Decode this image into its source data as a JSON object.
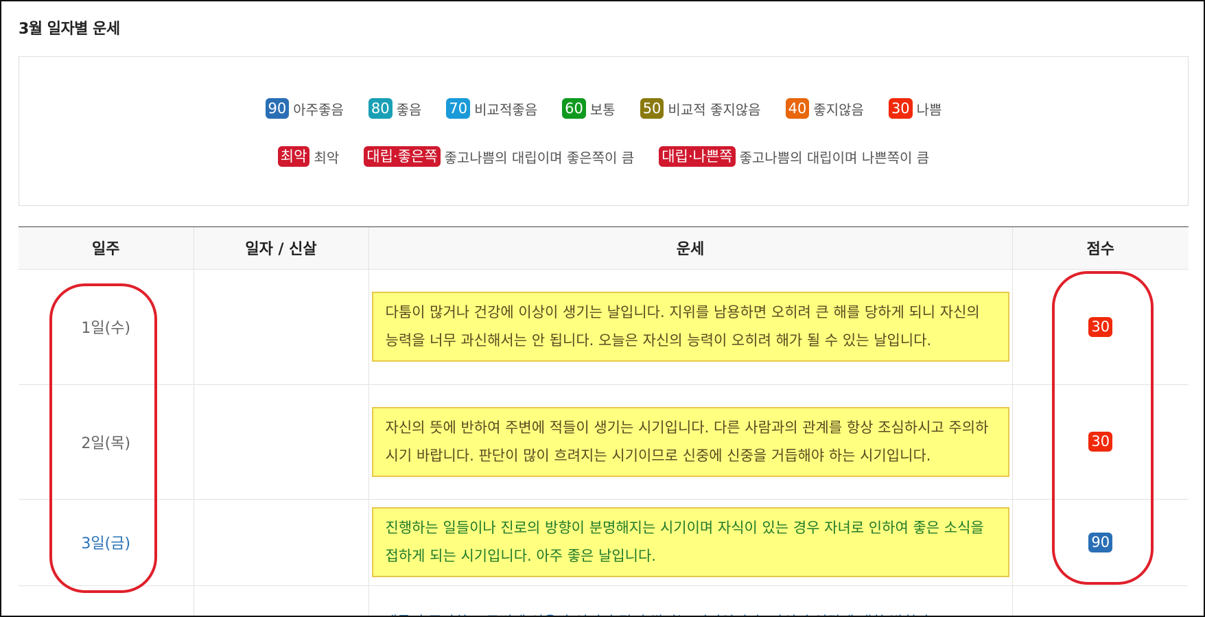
{
  "page_title": "3월 일자별 운세",
  "legend": {
    "row1": [
      {
        "badge": "90",
        "label": "아주좋음",
        "color": "#2a6fb5"
      },
      {
        "badge": "80",
        "label": "좋음",
        "color": "#1aa0b5"
      },
      {
        "badge": "70",
        "label": "비교적좋음",
        "color": "#1a9ad8"
      },
      {
        "badge": "60",
        "label": "보통",
        "color": "#0f9a1f"
      },
      {
        "badge": "50",
        "label": "비교적 좋지않음",
        "color": "#8a7a10"
      },
      {
        "badge": "40",
        "label": "좋지않음",
        "color": "#e8660e"
      },
      {
        "badge": "30",
        "label": "나쁨",
        "color": "#f02a0a"
      }
    ],
    "row2": [
      {
        "badge": "최악",
        "label": "최악",
        "color": "#d0192e"
      },
      {
        "badge": "대립·좋은쪽",
        "label": "좋고나쁨의 대립이며 좋은쪽이 큼",
        "color": "#d0192e"
      },
      {
        "badge": "대립·나쁜쪽",
        "label": "좋고나쁨의 대립이며 나쁜쪽이 큼",
        "color": "#d0192e"
      }
    ]
  },
  "table": {
    "headers": [
      "일주",
      "일자 / 신살",
      "운세",
      "점수"
    ],
    "rows": [
      {
        "day": "1일(수)",
        "shinsal": "",
        "fortune": "다툼이 많거나 건강에 이상이 생기는 날입니다. 지위를 남용하면 오히려 큰 해를 당하게 되니 자신의 능력을 너무 과신해서는 안 됩니다. 오늘은 자신의 능력이 오히려 해가 될 수 있는 날입니다.",
        "score": "30",
        "score_color": "#f02a0a"
      },
      {
        "day": "2일(목)",
        "shinsal": "",
        "fortune": "자신의 뜻에 반하여 주변에 적들이 생기는 시기입니다. 다른 사람과의 관계를 항상 조심하시고 주의하시기 바랍니다. 판단이 많이 흐려지는 시기이므로 신중에 신중을 거듭해야 하는 시기입니다.",
        "score": "30",
        "score_color": "#f02a0a"
      },
      {
        "day": "3일(금)",
        "shinsal": "",
        "fortune": "진행하는 일들이나 진로의 방향이 분명해지는 시기이며 자식이 있는 경우 자녀로 인하여 좋은 소식을 접하게 되는 시기입니다. 아주 좋은 날입니다.",
        "score": "90",
        "score_color": "#2a6fb5"
      },
      {
        "day": "",
        "shinsal": "",
        "fortune": "재물이 증가하고 주변에 신용과 신뢰가 많이 쌓이는 시기입니다. 자신의 역량에 대한 발휘가",
        "score": "",
        "score_color": "#2a6fb5"
      }
    ]
  }
}
